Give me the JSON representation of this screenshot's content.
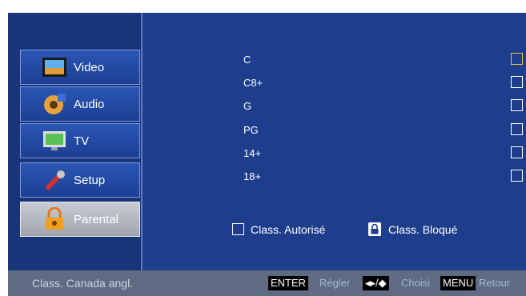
{
  "sidebar": {
    "items": [
      {
        "label": "Video",
        "icon": "video-icon"
      },
      {
        "label": "Audio",
        "icon": "audio-icon"
      },
      {
        "label": "TV",
        "icon": "tv-icon"
      },
      {
        "label": "Setup",
        "icon": "setup-icon"
      },
      {
        "label": "Parental",
        "icon": "lock-icon",
        "selected": true
      }
    ]
  },
  "ratings": [
    {
      "label": "C",
      "state": "focused"
    },
    {
      "label": "C8+",
      "state": "allowed"
    },
    {
      "label": "G",
      "state": "allowed"
    },
    {
      "label": "PG",
      "state": "allowed"
    },
    {
      "label": "14+",
      "state": "allowed"
    },
    {
      "label": "18+",
      "state": "allowed"
    }
  ],
  "legend": {
    "allowed": "Class. Autorisé",
    "blocked": "Class. Bloqué"
  },
  "footer": {
    "title": "Class. Canada angl.",
    "enter_key": "ENTER",
    "enter_action": "Régler",
    "nav_key": "◂▸/◆",
    "nav_action": "Choisi",
    "menu_key": "MENU",
    "menu_action": "Retour"
  },
  "colors": {
    "background": "#1e3d8c",
    "focus": "#e8c44a",
    "footer": "#5e6b83"
  }
}
